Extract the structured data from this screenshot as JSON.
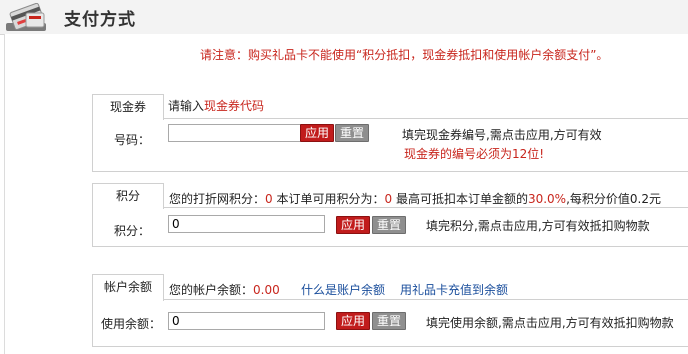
{
  "header": {
    "title": "支付方式",
    "icon": "credit-card-icon"
  },
  "notice": "请注意：购买礼品卡不能使用“积分抵扣，现金券抵扣和使用帐户余额支付”。",
  "coupon": {
    "tab": "现金券",
    "prompt": "请输入",
    "prompt_link": "现金券代码",
    "field_label": "号码：",
    "value": "",
    "apply": "应用",
    "reset": "重置",
    "hint": "填完现金券编号,需点击应用,方可有效",
    "error": "现金券的编号必须为12位!"
  },
  "points": {
    "tab": "积分",
    "info": {
      "p1": "您的打折网积分：",
      "v1": "0",
      "p2": " 本订单可用积分为：",
      "v2": "0",
      "p3": " 最高可抵扣本订单金额的",
      "v3": "30.0%",
      "p4": ",每积分价值0.2元"
    },
    "field_label": "积分：",
    "value": "0",
    "apply": "应用",
    "reset": "重置",
    "hint": "填完积分,需点击应用,方可有效抵扣购物款"
  },
  "balance": {
    "tab": "帐户余额",
    "info_label": "您的帐户余额：",
    "info_value": "0.00",
    "link1": "什么是账户余额",
    "link2": "用礼品卡充值到余额",
    "field_label": "使用余额：",
    "value": "0",
    "apply": "应用",
    "reset": "重置",
    "hint": "填完使用余额,需点击应用,方可有效抵扣购物款"
  }
}
